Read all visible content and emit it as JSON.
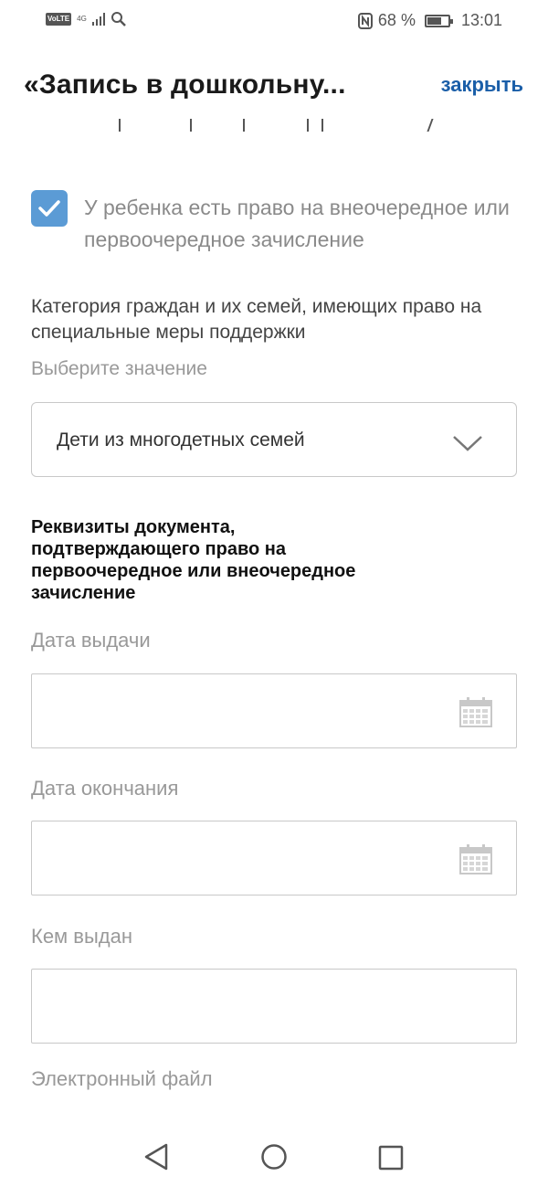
{
  "status_bar": {
    "volte": "VoLTE",
    "network": "4G",
    "battery_percent": "68 %",
    "battery_level": 0.68,
    "time": "13:01"
  },
  "header": {
    "title": "«Запись в дошкольну...",
    "close_label": "закрыть"
  },
  "priority_checkbox": {
    "checked": true,
    "label": "У ребенка есть право на внеочередное или первоочередное зачисление"
  },
  "category": {
    "label": "Категория граждан и их семей, имеющих право на специальные меры поддержки",
    "hint": "Выберите значение",
    "selected_value": "Дети из многодетных семей"
  },
  "document_section": {
    "title": "Реквизиты документа, подтверждающего право на первоочередное или внеочередное зачисление"
  },
  "fields": {
    "issue_date_label": "Дата выдачи",
    "end_date_label": "Дата окончания",
    "issued_by_label": "Кем выдан",
    "file_label": "Электронный файл"
  },
  "colors": {
    "accent": "#1a5ea8",
    "checkbox": "#5b9bd5"
  },
  "icons": {
    "calendar": "calendar-icon",
    "chevron": "chevron-down-icon"
  }
}
